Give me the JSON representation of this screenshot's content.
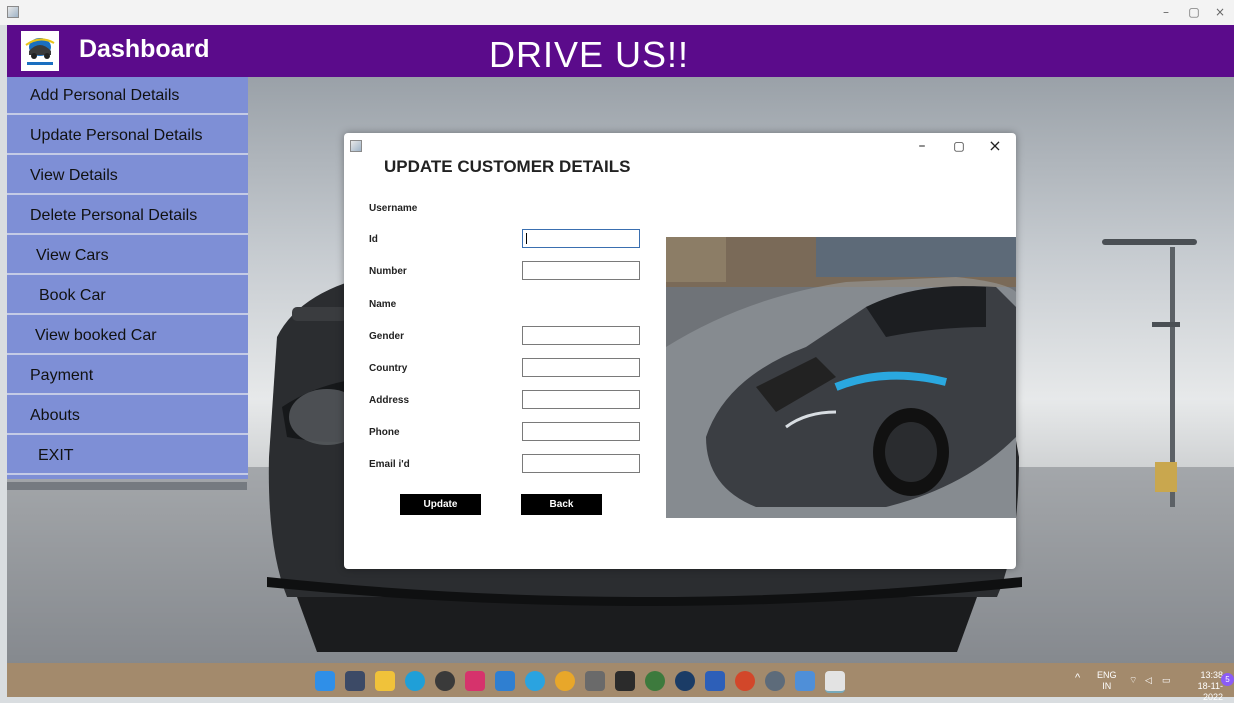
{
  "header": {
    "dashboard_label": "Dashboard",
    "app_title": "DRIVE US!!"
  },
  "window_controls": {
    "minimize": "–",
    "maximize": "▢",
    "close": "×"
  },
  "sidebar": {
    "items": [
      {
        "label": "Add Personal Details"
      },
      {
        "label": "Update Personal Details"
      },
      {
        "label": "View Details"
      },
      {
        "label": "Delete Personal Details"
      },
      {
        "label": "View Cars"
      },
      {
        "label": "Book Car"
      },
      {
        "label": "View booked Car"
      },
      {
        "label": "Payment"
      },
      {
        "label": "Abouts"
      },
      {
        "label": "EXIT"
      }
    ]
  },
  "dialog": {
    "heading": "UPDATE CUSTOMER DETAILS",
    "controls": {
      "minimize": "–",
      "maximize": "▢",
      "close": "×"
    },
    "fields": {
      "username_label": "Username",
      "id_label": "Id",
      "number_label": "Number",
      "name_label": "Name",
      "gender_label": "Gender",
      "country_label": "Country",
      "address_label": "Address",
      "phone_label": "Phone",
      "email_label": "Email i'd"
    },
    "values": {
      "id": "",
      "number": "",
      "gender": "",
      "country": "",
      "address": "",
      "phone": "",
      "email": ""
    },
    "buttons": {
      "update": "Update",
      "back": "Back"
    },
    "image": "sports-car-photo"
  },
  "taskbar": {
    "language": "ENG",
    "region": "IN",
    "time": "13:38",
    "date": "18-11-2022",
    "notification_count": "5",
    "icons": [
      "windows-start-icon",
      "task-view-icon",
      "file-explorer-icon",
      "edge-icon",
      "obs-icon",
      "instagram-icon",
      "vscode-icon",
      "telegram-icon",
      "chrome-icon",
      "game-icon",
      "epic-games-icon",
      "xbox-icon",
      "steam-icon",
      "word-icon",
      "powerpoint-icon",
      "settings-icon",
      "app-icon",
      "java-icon"
    ]
  },
  "colors": {
    "header": "#5b0b8b",
    "sidebar": "#7e8fd6",
    "button": "#000000"
  }
}
